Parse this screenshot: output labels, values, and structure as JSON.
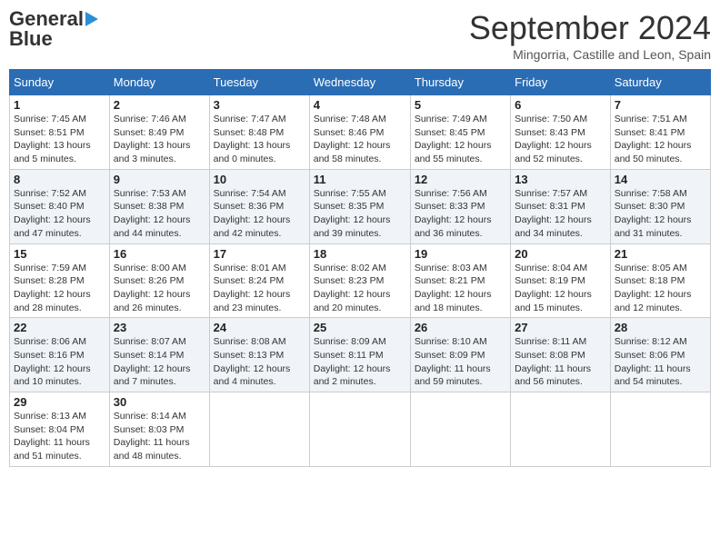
{
  "logo": {
    "line1": "General",
    "line2": "Blue"
  },
  "title": "September 2024",
  "location": "Mingorria, Castille and Leon, Spain",
  "days_of_week": [
    "Sunday",
    "Monday",
    "Tuesday",
    "Wednesday",
    "Thursday",
    "Friday",
    "Saturday"
  ],
  "weeks": [
    [
      {
        "day": "1",
        "sunrise": "7:45 AM",
        "sunset": "8:51 PM",
        "daylight": "13 hours and 5 minutes."
      },
      {
        "day": "2",
        "sunrise": "7:46 AM",
        "sunset": "8:49 PM",
        "daylight": "13 hours and 3 minutes."
      },
      {
        "day": "3",
        "sunrise": "7:47 AM",
        "sunset": "8:48 PM",
        "daylight": "13 hours and 0 minutes."
      },
      {
        "day": "4",
        "sunrise": "7:48 AM",
        "sunset": "8:46 PM",
        "daylight": "12 hours and 58 minutes."
      },
      {
        "day": "5",
        "sunrise": "7:49 AM",
        "sunset": "8:45 PM",
        "daylight": "12 hours and 55 minutes."
      },
      {
        "day": "6",
        "sunrise": "7:50 AM",
        "sunset": "8:43 PM",
        "daylight": "12 hours and 52 minutes."
      },
      {
        "day": "7",
        "sunrise": "7:51 AM",
        "sunset": "8:41 PM",
        "daylight": "12 hours and 50 minutes."
      }
    ],
    [
      {
        "day": "8",
        "sunrise": "7:52 AM",
        "sunset": "8:40 PM",
        "daylight": "12 hours and 47 minutes."
      },
      {
        "day": "9",
        "sunrise": "7:53 AM",
        "sunset": "8:38 PM",
        "daylight": "12 hours and 44 minutes."
      },
      {
        "day": "10",
        "sunrise": "7:54 AM",
        "sunset": "8:36 PM",
        "daylight": "12 hours and 42 minutes."
      },
      {
        "day": "11",
        "sunrise": "7:55 AM",
        "sunset": "8:35 PM",
        "daylight": "12 hours and 39 minutes."
      },
      {
        "day": "12",
        "sunrise": "7:56 AM",
        "sunset": "8:33 PM",
        "daylight": "12 hours and 36 minutes."
      },
      {
        "day": "13",
        "sunrise": "7:57 AM",
        "sunset": "8:31 PM",
        "daylight": "12 hours and 34 minutes."
      },
      {
        "day": "14",
        "sunrise": "7:58 AM",
        "sunset": "8:30 PM",
        "daylight": "12 hours and 31 minutes."
      }
    ],
    [
      {
        "day": "15",
        "sunrise": "7:59 AM",
        "sunset": "8:28 PM",
        "daylight": "12 hours and 28 minutes."
      },
      {
        "day": "16",
        "sunrise": "8:00 AM",
        "sunset": "8:26 PM",
        "daylight": "12 hours and 26 minutes."
      },
      {
        "day": "17",
        "sunrise": "8:01 AM",
        "sunset": "8:24 PM",
        "daylight": "12 hours and 23 minutes."
      },
      {
        "day": "18",
        "sunrise": "8:02 AM",
        "sunset": "8:23 PM",
        "daylight": "12 hours and 20 minutes."
      },
      {
        "day": "19",
        "sunrise": "8:03 AM",
        "sunset": "8:21 PM",
        "daylight": "12 hours and 18 minutes."
      },
      {
        "day": "20",
        "sunrise": "8:04 AM",
        "sunset": "8:19 PM",
        "daylight": "12 hours and 15 minutes."
      },
      {
        "day": "21",
        "sunrise": "8:05 AM",
        "sunset": "8:18 PM",
        "daylight": "12 hours and 12 minutes."
      }
    ],
    [
      {
        "day": "22",
        "sunrise": "8:06 AM",
        "sunset": "8:16 PM",
        "daylight": "12 hours and 10 minutes."
      },
      {
        "day": "23",
        "sunrise": "8:07 AM",
        "sunset": "8:14 PM",
        "daylight": "12 hours and 7 minutes."
      },
      {
        "day": "24",
        "sunrise": "8:08 AM",
        "sunset": "8:13 PM",
        "daylight": "12 hours and 4 minutes."
      },
      {
        "day": "25",
        "sunrise": "8:09 AM",
        "sunset": "8:11 PM",
        "daylight": "12 hours and 2 minutes."
      },
      {
        "day": "26",
        "sunrise": "8:10 AM",
        "sunset": "8:09 PM",
        "daylight": "11 hours and 59 minutes."
      },
      {
        "day": "27",
        "sunrise": "8:11 AM",
        "sunset": "8:08 PM",
        "daylight": "11 hours and 56 minutes."
      },
      {
        "day": "28",
        "sunrise": "8:12 AM",
        "sunset": "8:06 PM",
        "daylight": "11 hours and 54 minutes."
      }
    ],
    [
      {
        "day": "29",
        "sunrise": "8:13 AM",
        "sunset": "8:04 PM",
        "daylight": "11 hours and 51 minutes."
      },
      {
        "day": "30",
        "sunrise": "8:14 AM",
        "sunset": "8:03 PM",
        "daylight": "11 hours and 48 minutes."
      },
      null,
      null,
      null,
      null,
      null
    ]
  ]
}
